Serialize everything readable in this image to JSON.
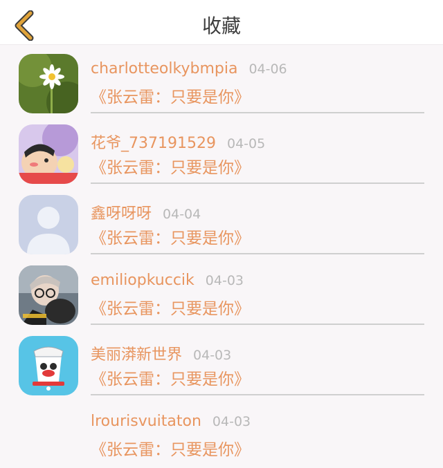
{
  "header": {
    "title": "收藏",
    "back_icon": "chevron-left-icon",
    "accent": "#e0a33a"
  },
  "items": [
    {
      "username": "charlotteolkybmpia",
      "date": "04-06",
      "content": "《张云雷：只要是你》",
      "avatar": "daisy-photo"
    },
    {
      "username": "花爷_737191529",
      "date": "04-05",
      "content": "《张云雷：只要是你》",
      "avatar": "cartoon-avatar"
    },
    {
      "username": "鑫呀呀呀",
      "date": "04-04",
      "content": "《张云雷：只要是你》",
      "avatar": "default-person"
    },
    {
      "username": "emiliopkuccik",
      "date": "04-03",
      "content": "《张云雷：只要是你》",
      "avatar": "person-photo"
    },
    {
      "username": "美丽漭新世界",
      "date": "04-03",
      "content": "《张云雷：只要是你》",
      "avatar": "monkey-cup"
    },
    {
      "username": "lrourisvuitaton",
      "date": "04-03",
      "content": "《张云雷：只要是你》",
      "avatar": "none"
    }
  ],
  "colors": {
    "name": "#e8955f",
    "date": "#b8b8b8",
    "background": "#f9f6f8"
  }
}
